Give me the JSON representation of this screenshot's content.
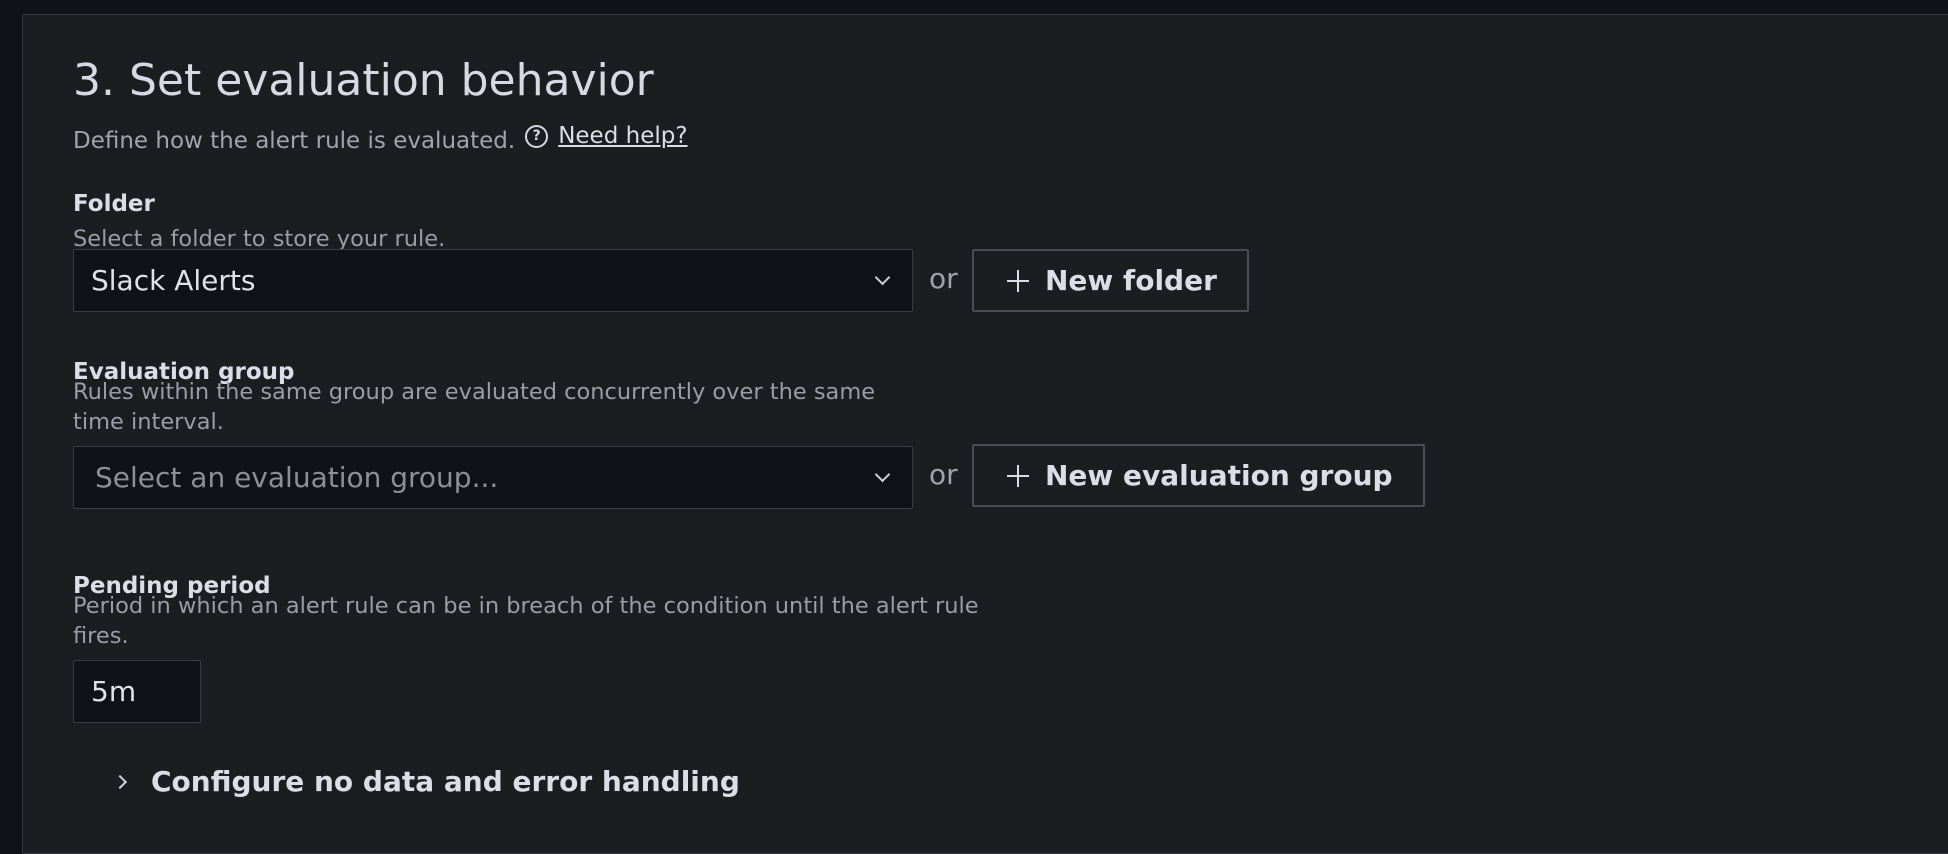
{
  "section": {
    "title": "3. Set evaluation behavior",
    "description": "Define how the alert rule is evaluated.",
    "help_link": "Need help?"
  },
  "folder": {
    "label": "Folder",
    "description": "Select a folder to store your rule.",
    "selected_value": "Slack Alerts",
    "or_text": "or",
    "new_button": "New folder"
  },
  "evaluation_group": {
    "label": "Evaluation group",
    "description": "Rules within the same group are evaluated concurrently over the same time interval.",
    "placeholder": "Select an evaluation group...",
    "or_text": "or",
    "new_button": "New evaluation group"
  },
  "pending_period": {
    "label": "Pending period",
    "description": "Period in which an alert rule can be in breach of the condition until the alert rule fires.",
    "value": "5m"
  },
  "no_data_section": {
    "label": "Configure no data and error handling"
  },
  "icons": {
    "help": "help-circle-icon",
    "dropdown": "chevron-down-icon",
    "add": "plus-icon",
    "expand": "chevron-right-icon"
  }
}
